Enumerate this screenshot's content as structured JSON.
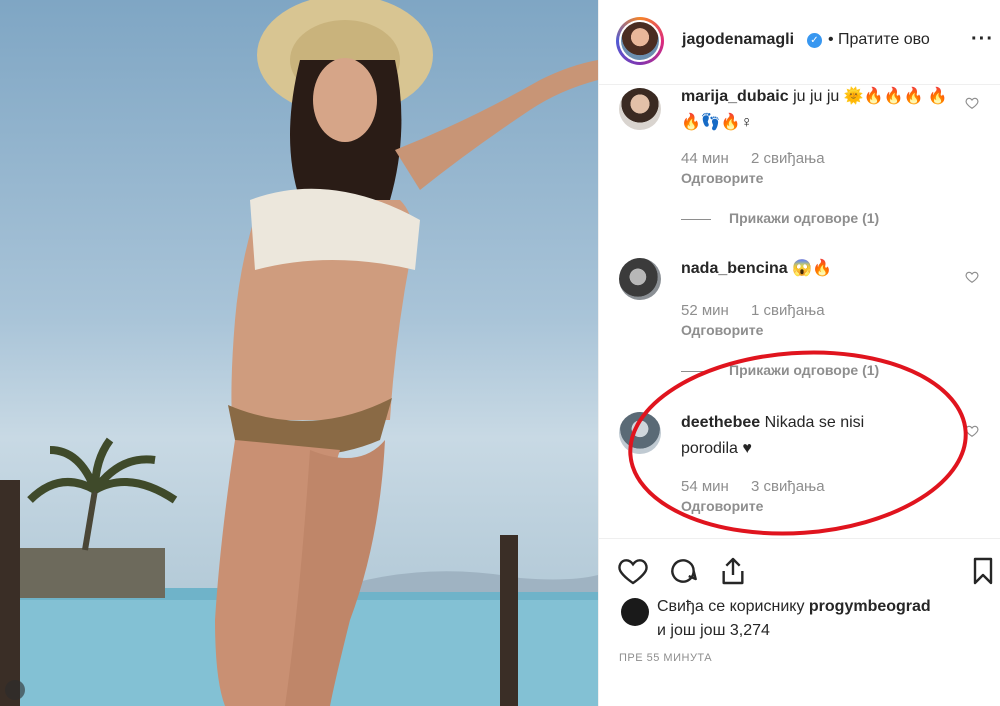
{
  "header": {
    "username": "jagodenamagli",
    "verified_icon": "✓",
    "separator": "•",
    "follow_label": "Пратите ово",
    "more_label": "···"
  },
  "comments": [
    {
      "user": "marija_dubaic",
      "text": "ju ju ju 🌞🔥🔥🔥 🔥🔥👣🔥♀",
      "time": "44 мин",
      "likes": "2 свиђања",
      "reply": "Одговорите",
      "view_replies": "Прикажи одговоре (1)"
    },
    {
      "user": "nada_bencina",
      "text": "😱🔥",
      "time": "52 мин",
      "likes": "1 свиђања",
      "reply": "Одговорите",
      "view_replies": "Прикажи одговоре (1)"
    },
    {
      "user": "deethebee",
      "text": "Nikada se nisi porodila ♥",
      "time": "54 мин",
      "likes": "3 свиђања",
      "reply": "Одговорите"
    }
  ],
  "likes": {
    "line1_prefix": "Свиђа се кориснику ",
    "line1_user": "progymbeograd",
    "line2": "и још још 3,274"
  },
  "time_ago": "ПРЕ 55 МИНУТА",
  "icons": {
    "like": "heart-icon",
    "comment": "comment-icon",
    "share": "share-icon",
    "save": "bookmark-icon"
  },
  "colors": {
    "annotation_circle": "#e0141e",
    "verified": "#3897f0",
    "secondary_text": "#8e8e8e"
  }
}
